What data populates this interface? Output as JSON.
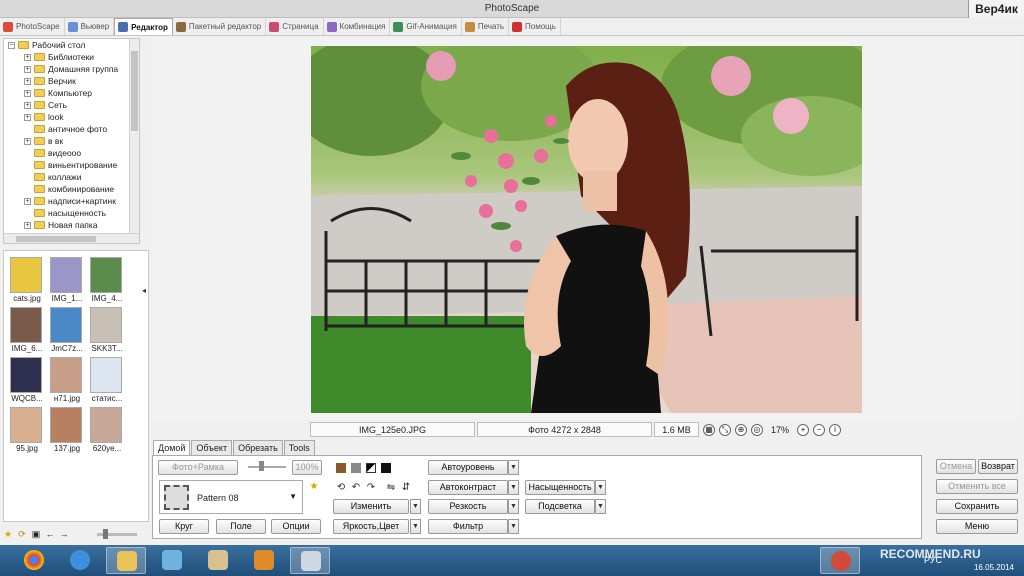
{
  "window": {
    "title": "PhotoScape",
    "watermark": "Вер4ик"
  },
  "tabs": [
    {
      "label": "PhotoScape",
      "icon": "photoscape-icon",
      "color": "#d94b3b"
    },
    {
      "label": "Вьювер",
      "icon": "viewer-icon",
      "color": "#6b8fd6"
    },
    {
      "label": "Редактор",
      "icon": "editor-icon",
      "color": "#4a6fb0"
    },
    {
      "label": "Пакетный редактор",
      "icon": "batch-icon",
      "color": "#8c6a3d"
    },
    {
      "label": "Страница",
      "icon": "page-icon",
      "color": "#cf4b6e"
    },
    {
      "label": "Комбинация",
      "icon": "combine-icon",
      "color": "#8a6bc2"
    },
    {
      "label": "Gif-Анимация",
      "icon": "gif-icon",
      "color": "#3d8e5a"
    },
    {
      "label": "Печать",
      "icon": "print-icon",
      "color": "#c98a3e"
    },
    {
      "label": "Помощь",
      "icon": "help-icon",
      "color": "#d23030"
    }
  ],
  "tree": {
    "items": [
      {
        "label": "Рабочий стол",
        "level": 0,
        "expander": "⊟"
      },
      {
        "label": "Библиотеки",
        "level": 1,
        "expander": "+"
      },
      {
        "label": "Домашняя группа",
        "level": 1,
        "expander": "+"
      },
      {
        "label": "Верчик",
        "level": 1,
        "expander": "+"
      },
      {
        "label": "Компьютер",
        "level": 1,
        "expander": "+"
      },
      {
        "label": "Сеть",
        "level": 1,
        "expander": "+"
      },
      {
        "label": "look",
        "level": 1,
        "expander": "+"
      },
      {
        "label": "античное фото",
        "level": 1,
        "expander": ""
      },
      {
        "label": "в вк",
        "level": 1,
        "expander": "+"
      },
      {
        "label": "видеооо",
        "level": 1,
        "expander": ""
      },
      {
        "label": "виньентирование",
        "level": 1,
        "expander": ""
      },
      {
        "label": "коллажи",
        "level": 1,
        "expander": ""
      },
      {
        "label": "комбинирование",
        "level": 1,
        "expander": ""
      },
      {
        "label": "надписи+картинк",
        "level": 1,
        "expander": "+"
      },
      {
        "label": "насыщенность",
        "level": 1,
        "expander": ""
      },
      {
        "label": "Новая папка",
        "level": 1,
        "expander": "+"
      }
    ]
  },
  "thumbnails": [
    {
      "caption": "cats.jpg",
      "color": "#e8c640"
    },
    {
      "caption": "IMG_1...",
      "color": "#9a96c8"
    },
    {
      "caption": "IMG_4...",
      "color": "#5c8c4c"
    },
    {
      "caption": "IMG_6...",
      "color": "#7a5a4a"
    },
    {
      "caption": "JmC7z...",
      "color": "#4a88c8"
    },
    {
      "caption": "SKK3T...",
      "color": "#c9c0b5"
    },
    {
      "caption": "WQCB...",
      "color": "#2f3050"
    },
    {
      "caption": "н71.jpg",
      "color": "#c8a08a"
    },
    {
      "caption": "статис...",
      "color": "#dde6f0"
    },
    {
      "caption": "95.jpg",
      "color": "#d8b090"
    },
    {
      "caption": "137.jpg",
      "color": "#b88060"
    },
    {
      "caption": "620уе...",
      "color": "#c8a898"
    }
  ],
  "status": {
    "filename": "IMG_125e0.JPG",
    "dimensions": "Фото 4272 x 2848",
    "filesize": "1.6 MB",
    "zoom": "17%"
  },
  "panel": {
    "tabs": [
      "Домой",
      "Объект",
      "Обрезать",
      "Tools"
    ],
    "frame_button": "Фото+Рамка",
    "brightness_value": "100%",
    "pattern": "Pattern 08",
    "circle": "Круг",
    "fields": "Поле",
    "options": "Опции",
    "resize": "Изменить",
    "brightness_color": "Яркость,Цвет",
    "auto_level": "Автоуровень",
    "auto_contrast": "Автоконтраст",
    "sharpness": "Резкость",
    "filter": "Фильтр",
    "saturation": "Насыщенность",
    "backlight": "Подсветка"
  },
  "actions": {
    "undo": "Отмена",
    "redo": "Возврат",
    "undo_all": "Отменить все",
    "save": "Сохранить",
    "menu": "Меню"
  },
  "taskbar": {
    "lang": "РУС",
    "date": "16.05.2014",
    "watermark": "RECOMMEND.RU"
  }
}
